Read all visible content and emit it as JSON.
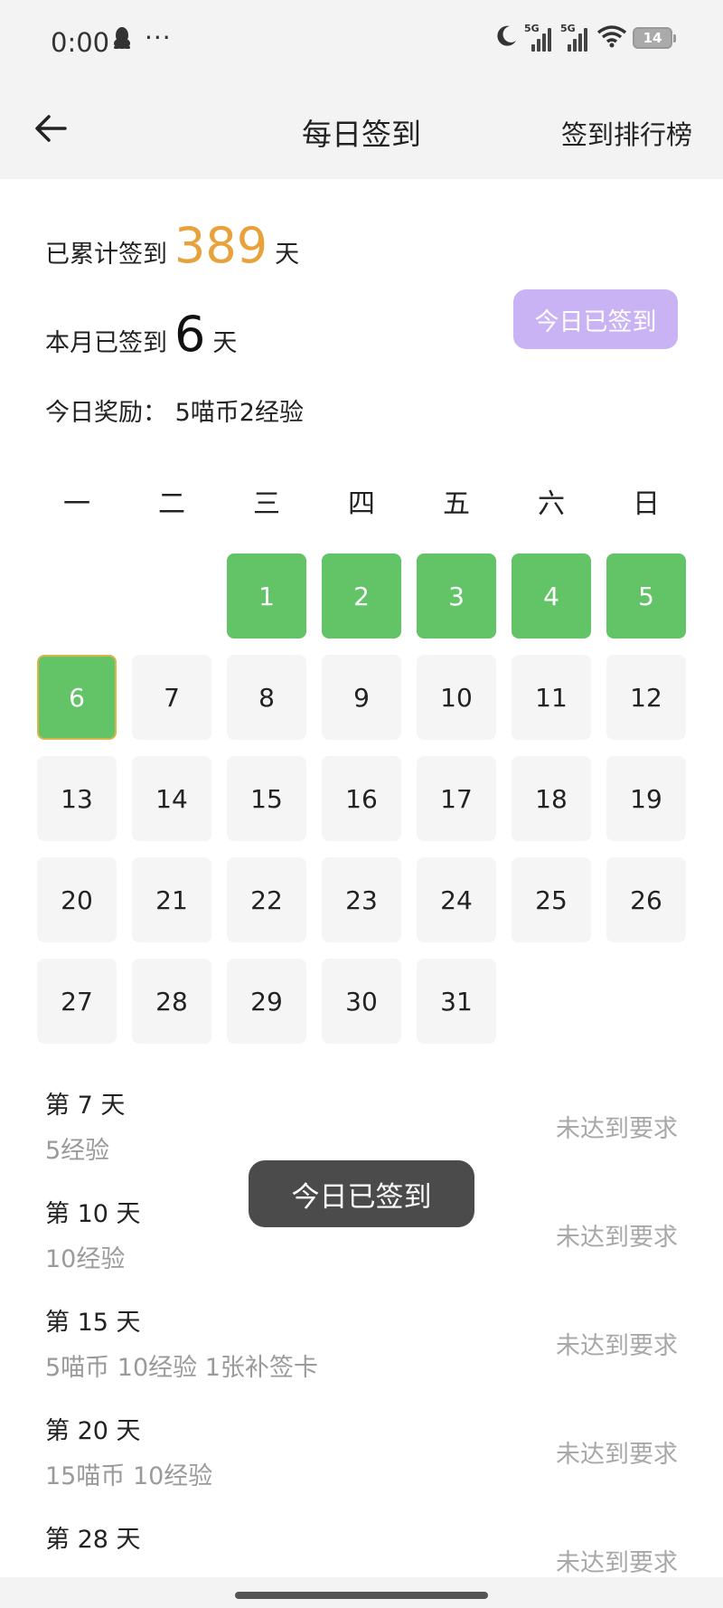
{
  "status_bar": {
    "time": "0:00",
    "more": "···",
    "signal1_label": "5G",
    "signal2_label": "5G",
    "battery": "14"
  },
  "header": {
    "title": "每日签到",
    "rank_link": "签到排行榜"
  },
  "stats": {
    "total_prefix": "已累计签到",
    "total_days": "389",
    "total_suffix": "天",
    "month_prefix": "本月已签到",
    "month_days": "6",
    "month_suffix": "天",
    "reward_today": "今日奖励：  5喵币2经验",
    "signed_button": "今日已签到"
  },
  "calendar": {
    "weekdays": [
      "一",
      "二",
      "三",
      "四",
      "五",
      "六",
      "日"
    ],
    "signed_days": [
      1,
      2,
      3,
      4,
      5,
      6
    ],
    "today": 6,
    "leading_blanks": 2,
    "days_in_month": 31
  },
  "milestones": [
    {
      "day": "第 7 天",
      "reward": "5经验",
      "status": "未达到要求"
    },
    {
      "day": "第 10 天",
      "reward": "10经验",
      "status": "未达到要求"
    },
    {
      "day": "第 15 天",
      "reward": "5喵币 10经验 1张补签卡",
      "status": "未达到要求"
    },
    {
      "day": "第 20 天",
      "reward": "15喵币 10经验",
      "status": "未达到要求"
    },
    {
      "day": "第 28 天",
      "reward": "",
      "status": "未达到要求"
    }
  ],
  "toast": "今日已签到",
  "colors": {
    "signed_green": "#62c466",
    "accent_orange": "#e9a23b",
    "button_purple": "#c9b3f5",
    "today_border": "#d9b54a"
  }
}
